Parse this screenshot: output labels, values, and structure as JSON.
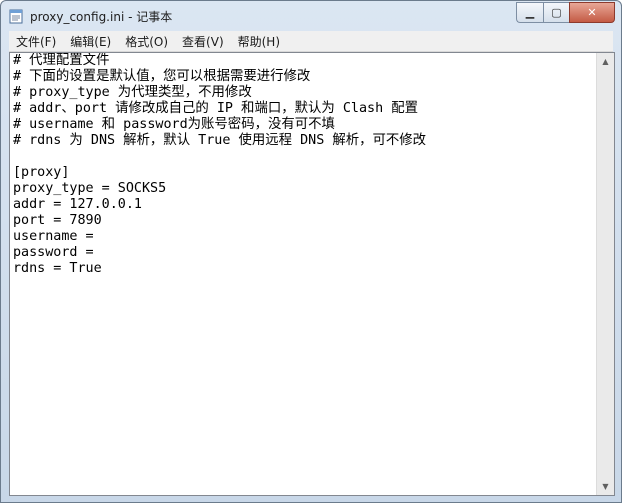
{
  "window": {
    "title": "proxy_config.ini - 记事本",
    "icon": "notepad-icon",
    "controls": {
      "minimize": "▁",
      "maximize": "▢",
      "close": "✕"
    }
  },
  "menu": [
    {
      "label": "文件(F)"
    },
    {
      "label": "编辑(E)"
    },
    {
      "label": "格式(O)"
    },
    {
      "label": "查看(V)"
    },
    {
      "label": "帮助(H)"
    }
  ],
  "editor": {
    "lines": [
      "# 代理配置文件",
      "# 下面的设置是默认值，您可以根据需要进行修改",
      "# proxy_type 为代理类型，不用修改",
      "# addr、port 请修改成自己的 IP 和端口，默认为 Clash 配置",
      "# username 和 password为账号密码，没有可不填",
      "# rdns 为 DNS 解析，默认 True 使用远程 DNS 解析，可不修改",
      "",
      "[proxy]",
      "proxy_type = SOCKS5",
      "addr = 127.0.0.1",
      "port = 7890",
      "username =",
      "password =",
      "rdns = True"
    ]
  },
  "scrollbar": {
    "up": "▲",
    "down": "▼"
  }
}
